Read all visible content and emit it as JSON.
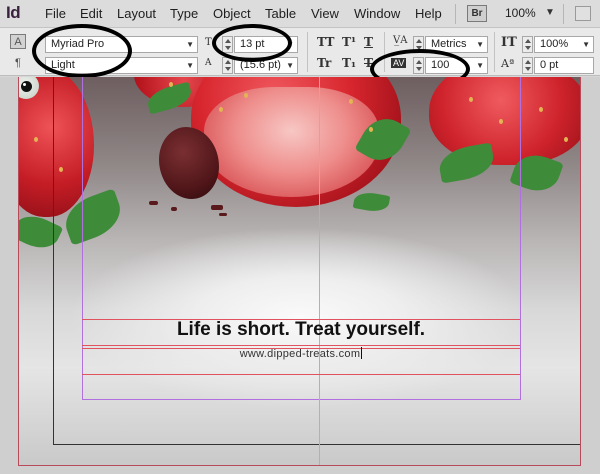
{
  "app": {
    "logo": "Id"
  },
  "menu": [
    "File",
    "Edit",
    "Layout",
    "Type",
    "Object",
    "Table",
    "View",
    "Window",
    "Help"
  ],
  "bridge_button": "Br",
  "zoom": {
    "value": "100%"
  },
  "control_panel": {
    "font_family": "Myriad Pro",
    "font_style": "Light",
    "font_size": "13 pt",
    "leading": "(15.6 pt)",
    "kerning": "Metrics",
    "tracking": "100",
    "vertical_scale": "100%",
    "baseline_shift": "0 pt",
    "tracking_icon_label": "AV"
  },
  "document": {
    "headline": "Life is short. Treat yourself.",
    "url": "www.dipped-treats.com"
  }
}
